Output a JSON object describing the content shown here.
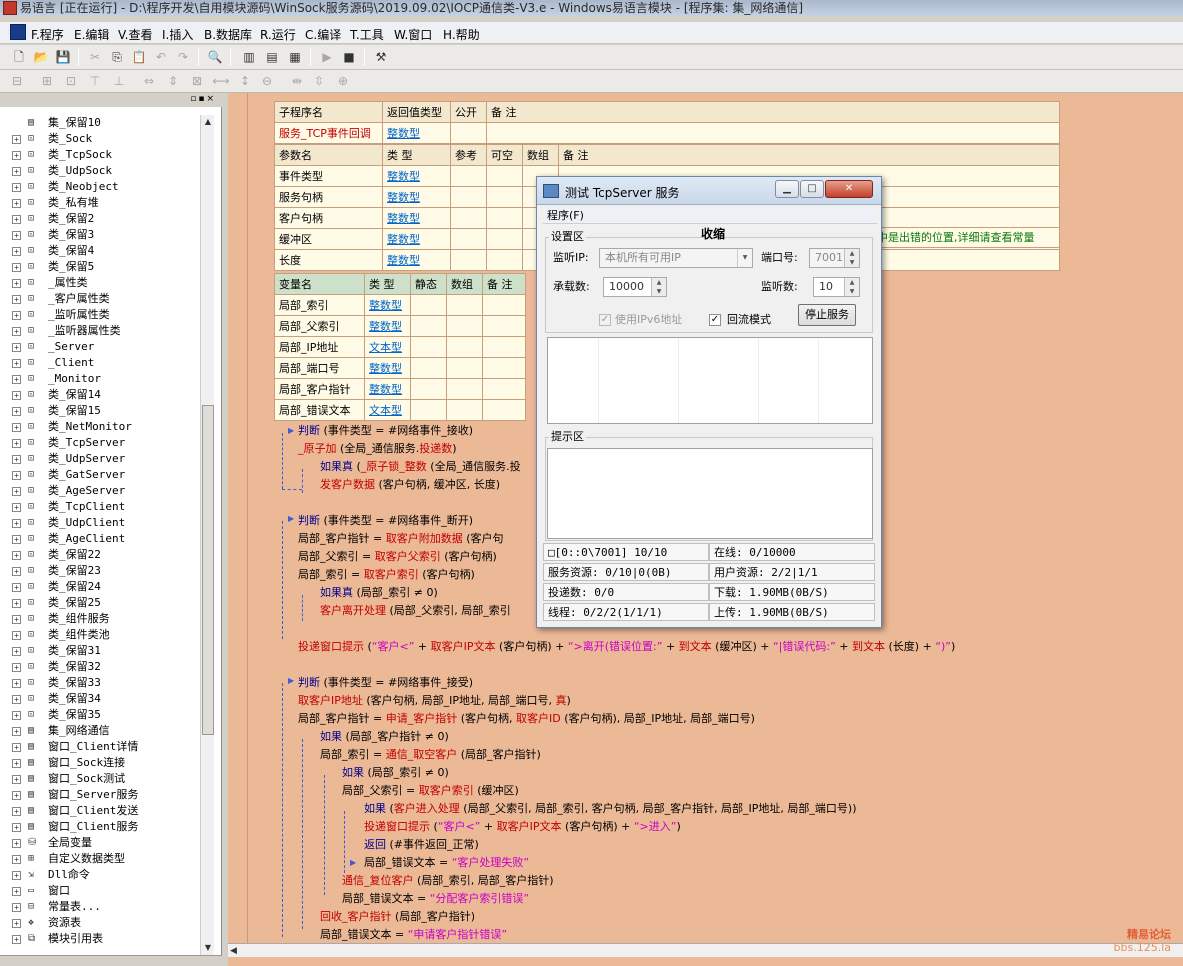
{
  "window_title": "易语言 [正在运行] - D:\\程序开发\\自用模块源码\\WinSock服务源码\\2019.09.02\\IOCP通信类-V3.e - Windows易语言模块 - [程序集: 集_网络通信]",
  "menu": [
    "F.程序",
    "E.编辑",
    "V.查看",
    "I.插入",
    "B.数据库",
    "R.运行",
    "C.编译",
    "T.工具",
    "W.窗口",
    "H.帮助"
  ],
  "tree": [
    {
      "label": "集_保留10",
      "icon": "module-icon"
    },
    {
      "label": "类_Sock",
      "icon": "class-icon"
    },
    {
      "label": "类_TcpSock",
      "icon": "class-icon"
    },
    {
      "label": "类_UdpSock",
      "icon": "class-icon"
    },
    {
      "label": "类_Neobject",
      "icon": "class-icon"
    },
    {
      "label": "类_私有堆",
      "icon": "class-icon"
    },
    {
      "label": "类_保留2",
      "icon": "class-icon"
    },
    {
      "label": "类_保留3",
      "icon": "class-icon"
    },
    {
      "label": "类_保留4",
      "icon": "class-icon"
    },
    {
      "label": "类_保留5",
      "icon": "class-icon"
    },
    {
      "label": "_属性类",
      "icon": "class-icon"
    },
    {
      "label": "_客户属性类",
      "icon": "class-icon"
    },
    {
      "label": "_监听属性类",
      "icon": "class-icon"
    },
    {
      "label": "_监听器属性类",
      "icon": "class-icon"
    },
    {
      "label": "_Server",
      "icon": "class-icon"
    },
    {
      "label": "_Client",
      "icon": "class-icon"
    },
    {
      "label": "_Monitor",
      "icon": "class-icon"
    },
    {
      "label": "类_保留14",
      "icon": "class-icon"
    },
    {
      "label": "类_保留15",
      "icon": "class-icon"
    },
    {
      "label": "类_NetMonitor",
      "icon": "class-icon"
    },
    {
      "label": "类_TcpServer",
      "icon": "class-icon"
    },
    {
      "label": "类_UdpServer",
      "icon": "class-icon"
    },
    {
      "label": "类_GatServer",
      "icon": "class-icon"
    },
    {
      "label": "类_AgeServer",
      "icon": "class-icon"
    },
    {
      "label": "类_TcpClient",
      "icon": "class-icon"
    },
    {
      "label": "类_UdpClient",
      "icon": "class-icon"
    },
    {
      "label": "类_AgeClient",
      "icon": "class-icon"
    },
    {
      "label": "类_保留22",
      "icon": "class-icon"
    },
    {
      "label": "类_保留23",
      "icon": "class-icon"
    },
    {
      "label": "类_保留24",
      "icon": "class-icon"
    },
    {
      "label": "类_保留25",
      "icon": "class-icon"
    },
    {
      "label": "类_组件服务",
      "icon": "class-icon"
    },
    {
      "label": "类_组件类池",
      "icon": "class-icon"
    },
    {
      "label": "类_保留31",
      "icon": "class-icon"
    },
    {
      "label": "类_保留32",
      "icon": "class-icon"
    },
    {
      "label": "类_保留33",
      "icon": "class-icon"
    },
    {
      "label": "类_保留34",
      "icon": "class-icon"
    },
    {
      "label": "类_保留35",
      "icon": "class-icon"
    },
    {
      "label": "集_网络通信",
      "icon": "module-icon"
    },
    {
      "label": "窗口_Client详情",
      "icon": "module-icon"
    },
    {
      "label": "窗口_Sock连接",
      "icon": "module-icon"
    },
    {
      "label": "窗口_Sock测试",
      "icon": "module-icon"
    },
    {
      "label": "窗口_Server服务",
      "icon": "module-icon"
    },
    {
      "label": "窗口_Client发送",
      "icon": "module-icon"
    },
    {
      "label": "窗口_Client服务",
      "icon": "module-icon"
    },
    {
      "label": "全局变量",
      "icon": "global-icon"
    },
    {
      "label": "自定义数据类型",
      "icon": "type-icon"
    },
    {
      "label": "Dll命令",
      "icon": "dll-icon"
    },
    {
      "label": "窗口",
      "icon": "window-icon"
    },
    {
      "label": "常量表...",
      "icon": "const-icon"
    },
    {
      "label": "资源表",
      "icon": "resource-icon"
    },
    {
      "label": "模块引用表",
      "icon": "ref-icon"
    }
  ],
  "sub_table": {
    "headers": [
      "子程序名",
      "返回值类型",
      "公开",
      "备 注"
    ],
    "name": "服务_TCP事件回调",
    "return_type": "整数型"
  },
  "param_table": {
    "headers": [
      "参数名",
      "类 型",
      "参考",
      "可空",
      "数组",
      "备 注"
    ],
    "rows": [
      {
        "name": "事件类型",
        "type": "整数型"
      },
      {
        "name": "服务句柄",
        "type": "整数型"
      },
      {
        "name": "客户句柄",
        "type": "整数型"
      },
      {
        "name": "缓冲区",
        "type": "整数型"
      },
      {
        "name": "长度",
        "type": "整数型"
      }
    ],
    "note_visible": "中是出错的位置,详细请查看常量"
  },
  "var_table": {
    "headers": [
      "变量名",
      "类 型",
      "静态",
      "数组",
      "备 注"
    ],
    "rows": [
      {
        "name": "局部_索引",
        "type": "整数型"
      },
      {
        "name": "局部_父索引",
        "type": "整数型"
      },
      {
        "name": "局部_IP地址",
        "type": "文本型"
      },
      {
        "name": "局部_端口号",
        "type": "整数型"
      },
      {
        "name": "局部_客户指针",
        "type": "整数型"
      },
      {
        "name": "局部_错误文本",
        "type": "文本型"
      }
    ]
  },
  "code": {
    "l1": [
      "判断",
      " (事件类型 = #网络事件_接收)"
    ],
    "l2": [
      "_原子加",
      " (全局_通信服务.",
      "投递数",
      ")"
    ],
    "l3": [
      "如果真",
      " (",
      "_原子锁_整数",
      " (全局_通信服务.投"
    ],
    "l4": [
      "发客户数据",
      " (客户句柄, 缓冲区, 长度)"
    ],
    "l5": [
      "判断",
      " (事件类型 = #网络事件_断开)"
    ],
    "l6": [
      "局部_客户指针 = ",
      "取客户附加数据",
      " (客户句"
    ],
    "l7": [
      "局部_父索引 = ",
      "取客户父索引",
      " (客户句柄)"
    ],
    "l8": [
      "局部_索引 = ",
      "取客户索引",
      " (客户句柄)"
    ],
    "l9": [
      "如果真",
      " (局部_索引 ≠ 0)"
    ],
    "l10": [
      "客户离开处理",
      " (局部_父索引, 局部_索引"
    ],
    "l11": [
      "投递窗口提示",
      " (",
      "“客户<”",
      " + ",
      "取客户IP文本",
      " (客户句柄) + ",
      "“>离开(错误位置:”",
      " + ",
      "到文本",
      " (缓冲区) + ",
      "“|错误代码:”",
      " + ",
      "到文本",
      " (长度) + ",
      "“)”",
      ")"
    ],
    "l12": [
      "判断",
      " (事件类型 = #网络事件_接受)"
    ],
    "l13": [
      "取客户IP地址",
      " (客户句柄, 局部_IP地址, 局部_端口号, ",
      "真",
      ")"
    ],
    "l14": [
      "局部_客户指针 = ",
      "申请_客户指针",
      " (客户句柄, ",
      "取客户ID",
      " (客户句柄), 局部_IP地址, 局部_端口号)"
    ],
    "l15": [
      "如果",
      " (局部_客户指针 ≠ 0)"
    ],
    "l16": [
      "局部_索引 = ",
      "通信_取空客户",
      " (局部_客户指针)"
    ],
    "l17": [
      "如果",
      " (局部_索引 ≠ 0)"
    ],
    "l18": [
      "局部_父索引 = ",
      "取客户索引",
      " (缓冲区)"
    ],
    "l19": [
      "如果",
      " (",
      "客户进入处理",
      " (局部_父索引, 局部_索引, 客户句柄, 局部_客户指针, 局部_IP地址, 局部_端口号))"
    ],
    "l20": [
      "投递窗口提示",
      " (",
      "“客户<”",
      " + ",
      "取客户IP文本",
      " (客户句柄) + ",
      "“>进入”",
      ")"
    ],
    "l21": [
      "返回",
      " (#事件返回_正常)"
    ],
    "l22": [
      "局部_错误文本 = ",
      "“客户处理失败”"
    ],
    "l23": [
      "通信_复位客户",
      " (局部_索引, 局部_客户指针)"
    ],
    "l24": [
      "局部_错误文本 = ",
      "“分配客户索引错误”"
    ],
    "l25": [
      "回收_客户指针",
      " (局部_客户指针)"
    ],
    "l26": [
      "局部_错误文本 = ",
      "“申请客户指针错误”"
    ]
  },
  "dialog": {
    "title": "测试 TcpServer 服务",
    "menu": "程序(F)",
    "group_settings": "设置区",
    "collapse_label": "收缩",
    "listen_ip_label": "监听IP:",
    "listen_ip_value": "本机所有可用IP",
    "port_label": "端口号:",
    "port_value": "7001",
    "capacity_label": "承载数:",
    "capacity_value": "10000",
    "listen_count_label": "监听数:",
    "listen_count_value": "10",
    "ipv6_label": "使用IPv6地址",
    "ipv6_checked": true,
    "loopback_label": "回流模式",
    "loopback_checked": true,
    "stop_button": "停止服务",
    "group_tips": "提示区",
    "status": {
      "s1": "□[0::0\\7001] 10/10",
      "s2": "在线: 0/10000",
      "s3": "服务资源: 0/10|0(0B)",
      "s4": "用户资源: 2/2|1/1",
      "s5": "投递数: 0/0",
      "s6": "下载: 1.90MB(0B/S)",
      "s7": "线程: 0/2/2(1/1/1)",
      "s8": "上传: 1.90MB(0B/S)"
    }
  },
  "watermark": {
    "line1": "精易论坛",
    "line2": "bbs.125.la"
  }
}
